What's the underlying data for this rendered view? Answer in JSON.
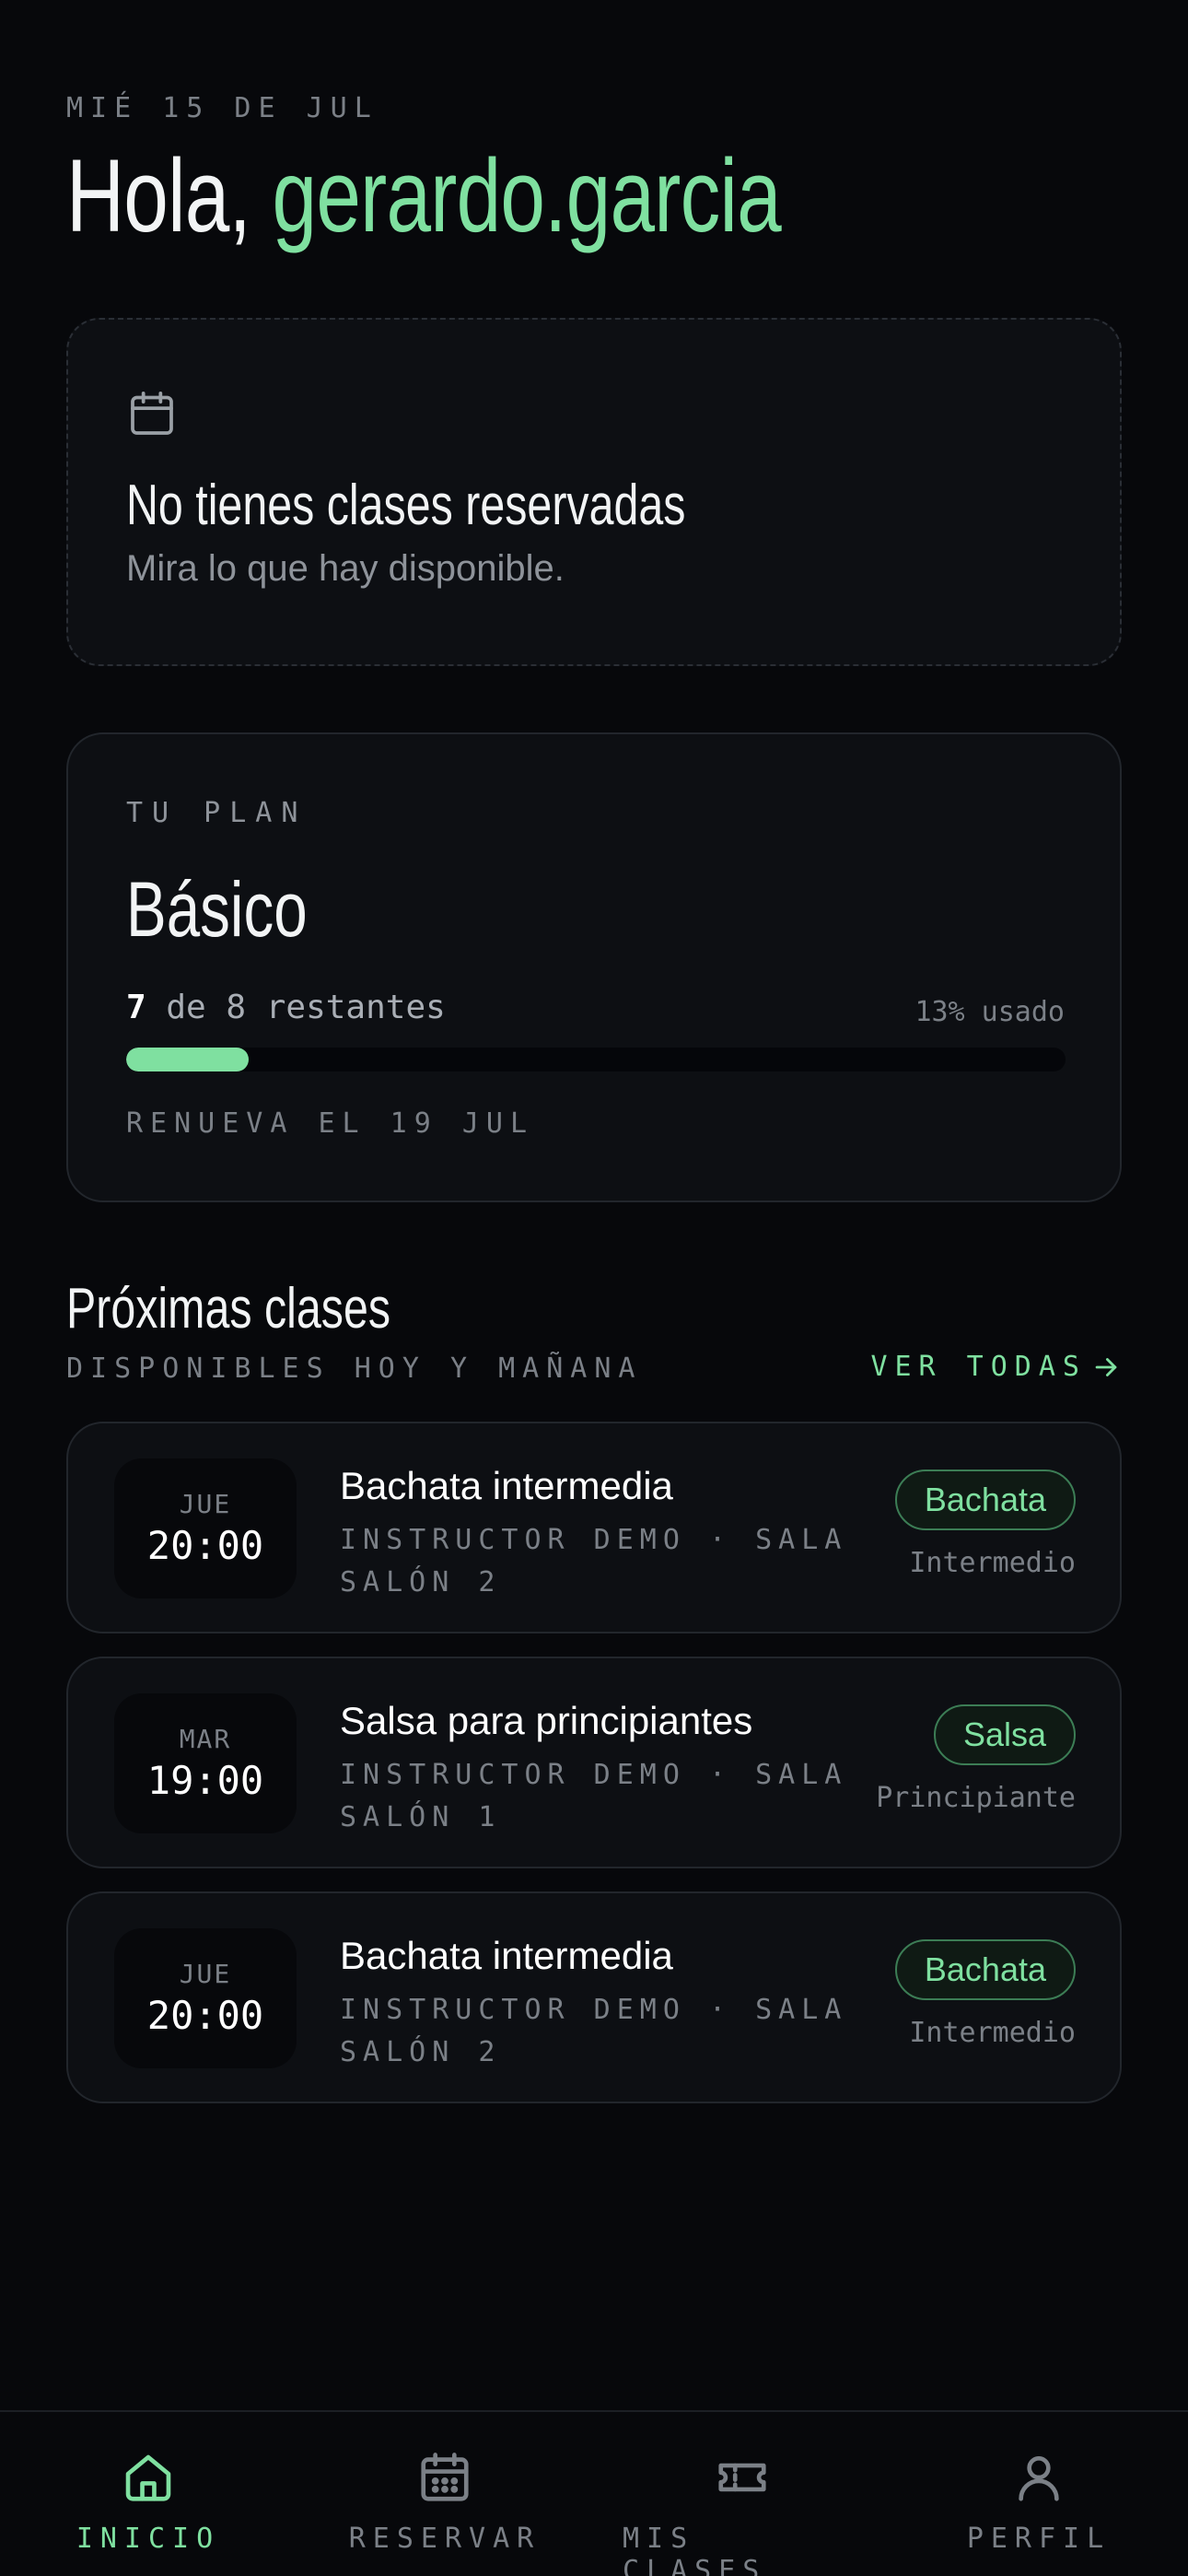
{
  "header": {
    "date": "MIÉ 15 DE JUL",
    "greeting_prefix": "Hola, ",
    "username": "gerardo.garcia"
  },
  "empty_state": {
    "title": "No tienes clases reservadas",
    "subtitle": "Mira lo que hay disponible.",
    "icon": "calendar-icon"
  },
  "plan": {
    "label": "TU PLAN",
    "name": "Básico",
    "remaining_count": "7",
    "remaining_text": " de 8 restantes",
    "used_text": "13% usado",
    "used_fraction": 0.13,
    "renew_text": "RENUEVA EL 19 JUL"
  },
  "upcoming": {
    "title": "Próximas clases",
    "subtitle": "DISPONIBLES HOY Y MAÑANA",
    "see_all": "VER TODAS",
    "classes": [
      {
        "day": "JUE",
        "time": "20:00",
        "name": "Bachata intermedia",
        "meta": "INSTRUCTOR DEMO · SALA SALÓN 2",
        "style": "Bachata",
        "level": "Intermedio"
      },
      {
        "day": "MAR",
        "time": "19:00",
        "name": "Salsa para principiantes",
        "meta": "INSTRUCTOR DEMO · SALA SALÓN 1",
        "style": "Salsa",
        "level": "Principiante"
      },
      {
        "day": "JUE",
        "time": "20:00",
        "name": "Bachata intermedia",
        "meta": "INSTRUCTOR DEMO · SALA SALÓN 2",
        "style": "Bachata",
        "level": "Intermedio"
      }
    ]
  },
  "nav": {
    "items": [
      {
        "label": "INICIO",
        "icon": "home-icon",
        "active": true
      },
      {
        "label": "RESERVAR",
        "icon": "calendar-icon",
        "active": false
      },
      {
        "label": "MIS CLASES",
        "icon": "ticket-icon",
        "active": false
      },
      {
        "label": "PERFIL",
        "icon": "user-icon",
        "active": false
      }
    ]
  },
  "colors": {
    "accent": "#7fe0a0",
    "background": "#07080b",
    "card": "#0d0f13"
  }
}
